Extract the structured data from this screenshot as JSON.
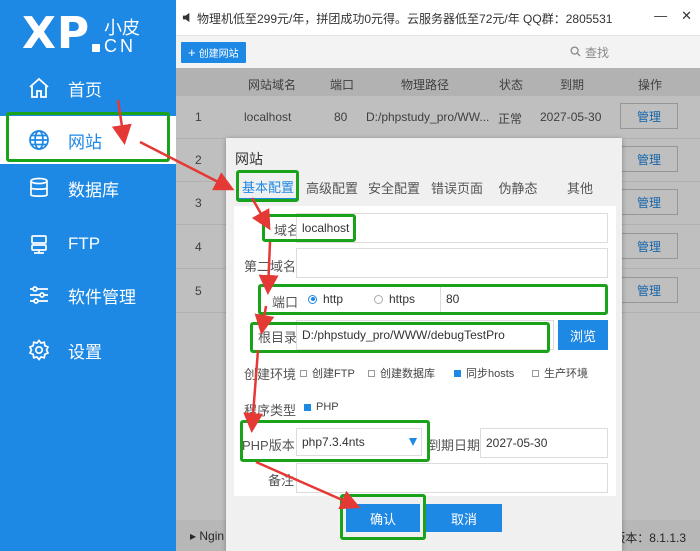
{
  "app": {
    "logo_main": "XP",
    "logo_cn_top": "小皮",
    "logo_cn_bottom": "CN",
    "announcement": "物理机低至299元/年，拼团成功0元得。云服务器低至72元/年 QQ群：2805531",
    "brand_color": "#1e88e5",
    "annotation_color": "#1aa31a"
  },
  "sidebar": {
    "items": [
      {
        "label": "首页",
        "icon": "home-icon"
      },
      {
        "label": "网站",
        "icon": "globe-icon",
        "active": true
      },
      {
        "label": "数据库",
        "icon": "database-icon"
      },
      {
        "label": "FTP",
        "icon": "ftp-icon"
      },
      {
        "label": "软件管理",
        "icon": "sliders-icon"
      },
      {
        "label": "设置",
        "icon": "gear-icon"
      }
    ]
  },
  "toolbar": {
    "create_label": "创建网站",
    "search_label": "查找"
  },
  "table": {
    "headers": [
      "网站域名",
      "端口",
      "物理路径",
      "状态",
      "到期",
      "操作"
    ],
    "rows": [
      {
        "num": "1",
        "domain": "localhost",
        "port": "80",
        "path": "D:/phpstudy_pro/WW...",
        "status": "正常",
        "expire": "2027-05-30",
        "action": "管理"
      },
      {
        "num": "2",
        "action": "管理"
      },
      {
        "num": "3",
        "action": "管理"
      },
      {
        "num": "4",
        "action": "管理"
      },
      {
        "num": "5",
        "action": "管理"
      }
    ]
  },
  "statusbar": {
    "left": "Ngin",
    "right": "版本：8.1.1.3"
  },
  "dialog": {
    "title": "网站",
    "tabs": [
      "基本配置",
      "高级配置",
      "安全配置",
      "错误页面",
      "伪静态",
      "其他"
    ],
    "fields": {
      "domain_label": "域名",
      "domain_value": "localhost",
      "second_domain_label": "第二域名",
      "second_domain_value": "",
      "port_label": "端口",
      "protocol_http": "http",
      "protocol_https": "https",
      "port_value": "80",
      "root_label": "根目录",
      "root_value": "D:/phpstudy_pro/WWW/debugTestPro",
      "browse_label": "浏览",
      "env_label": "创建环境",
      "env_options": [
        "创建FTP",
        "创建数据库",
        "同步hosts",
        "生产环境"
      ],
      "program_label": "程序类型",
      "program_value": "PHP",
      "php_label": "PHP版本",
      "php_value": "php7.3.4nts",
      "expire_label": "到期日期",
      "expire_value": "2027-05-30",
      "note_label": "备注",
      "note_value": ""
    },
    "ok_label": "确认",
    "cancel_label": "取消"
  }
}
